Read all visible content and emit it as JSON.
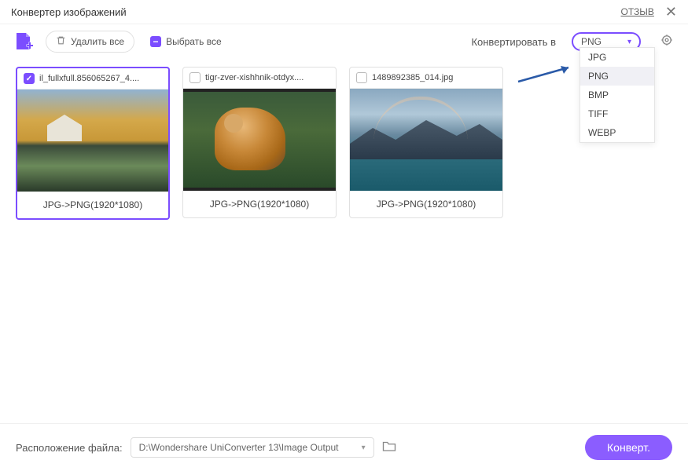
{
  "titlebar": {
    "title": "Конвертер изображений",
    "feedback": "ОТЗЫВ"
  },
  "toolbar": {
    "delete_all": "Удалить все",
    "select_all": "Выбрать все",
    "convert_to_label": "Конвертировать в",
    "format_selected": "PNG"
  },
  "dropdown": {
    "options": [
      "JPG",
      "PNG",
      "BMP",
      "TIFF",
      "WEBP"
    ],
    "selected": "PNG"
  },
  "cards": [
    {
      "filename": "il_fullxfull.856065267_4....",
      "conversion": "JPG->PNG(1920*1080)",
      "checked": true,
      "thumb": "autumn"
    },
    {
      "filename": "tigr-zver-xishhnik-otdyx....",
      "conversion": "JPG->PNG(1920*1080)",
      "checked": false,
      "thumb": "tiger"
    },
    {
      "filename": "1489892385_014.jpg",
      "conversion": "JPG->PNG(1920*1080)",
      "checked": false,
      "thumb": "mountain"
    }
  ],
  "footer": {
    "location_label": "Расположение файла:",
    "path": "D:\\Wondershare UniConverter 13\\Image Output",
    "convert_btn": "Конверт."
  }
}
